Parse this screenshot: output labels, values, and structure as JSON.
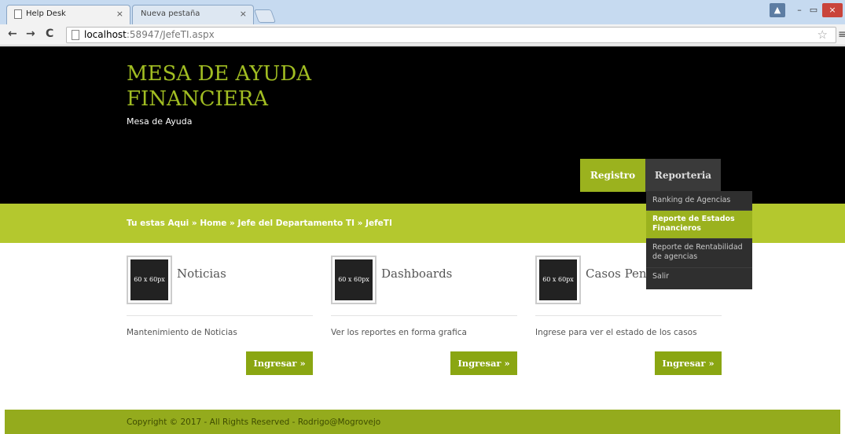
{
  "browser": {
    "tabs": [
      {
        "label": "Help Desk",
        "close": "×"
      },
      {
        "label": "Nueva pestaña",
        "close": "×"
      }
    ],
    "url_host": "localhost",
    "url_rest": ":58947/JefeTI.aspx",
    "icons": {
      "back": "←",
      "forward": "→",
      "reload": "C",
      "star": "☆",
      "menu": "≡"
    },
    "window_controls": {
      "user": "▲",
      "minimize": "–",
      "maximize": "▭",
      "close": "×"
    }
  },
  "site": {
    "logo_title": "MESA DE AYUDA FINANCIERA",
    "logo_subtitle": "Mesa de Ayuda",
    "nav": {
      "registro": "Registro",
      "reporteria": "Reporteria"
    },
    "dropdown": [
      "Ranking de Agencias",
      "Reporte de Estados Financieros",
      "Reporte de Rentabilidad de agencias",
      "Salir"
    ],
    "breadcrumb": "Tu estas Aqui » Home » Jefe del Departamento TI » JefeTI",
    "boxes": [
      {
        "thumb": "60 x 60px",
        "title": "Noticias",
        "desc": "Mantenimiento de Noticias",
        "button": "Ingresar »"
      },
      {
        "thumb": "60 x 60px",
        "title": "Dashboards",
        "desc": "Ver los reportes en forma grafica",
        "button": "Ingresar »"
      },
      {
        "thumb": "60 x 60px",
        "title": "Casos Pendientes",
        "desc": "Ingrese para ver el estado de los casos",
        "button": "Ingresar »"
      }
    ],
    "footer": "Copyright © 2017 - All Rights Reserved - Rodrigo@Mogrovejo"
  },
  "colors": {
    "accent_green": "#b4c82e",
    "logo_green": "#a1bd22",
    "button_green": "#8aa612",
    "header_black": "#000000"
  }
}
